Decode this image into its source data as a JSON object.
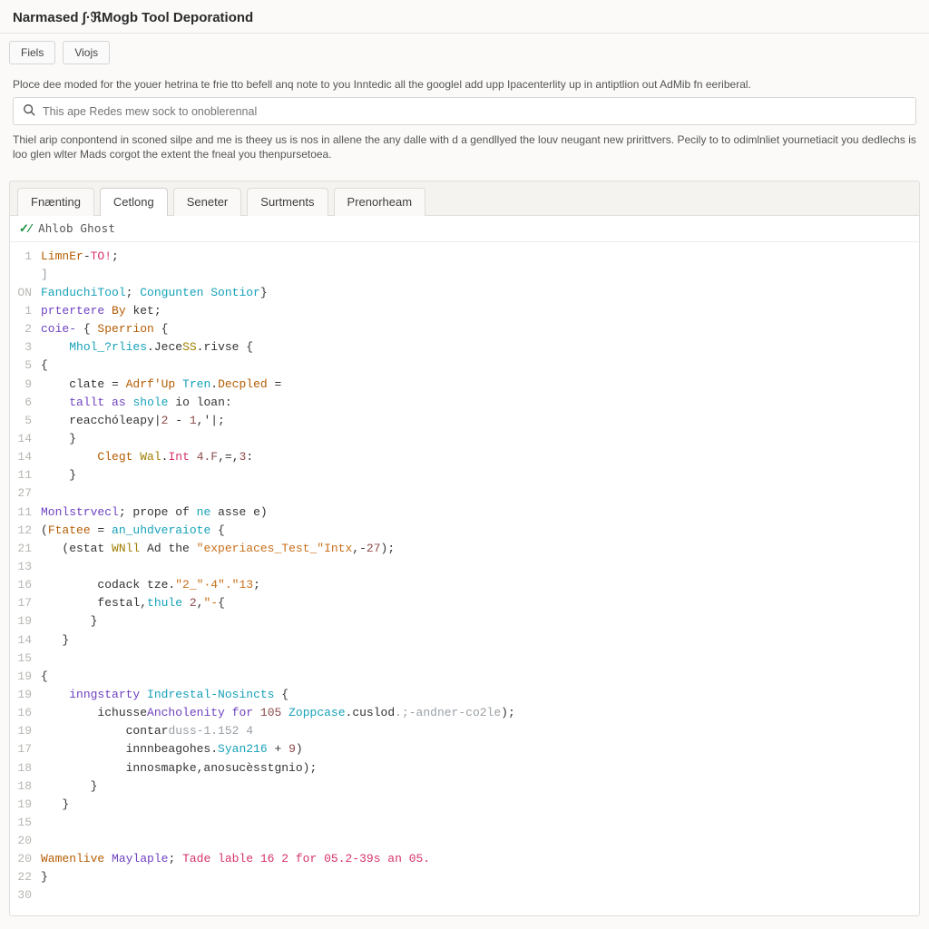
{
  "header": {
    "title": "Narmased ∫·ℜMogb Tool Deporationd"
  },
  "buttons": {
    "file": "Fiels",
    "views": "Viojs"
  },
  "intro": {
    "line1": "Ploce dee moded for the youer hetrina te frie tto befell anq note to you Inntedic all the googlel add upp Ipacenterlity up in antiptlion out AdMib fn eeriberal.",
    "line2": "Thiel arip conpontend in sconed silpe and me is theey us is nos in allene the any dalle with d a gendllyed the louv neugant new pririttvers. Pecily to to odimlnliet yournetiacit you dedlechs is loo glen wlter Mads corgot the extent the fneal you thenpursetoea."
  },
  "search": {
    "placeholder": "This ape Redes mew sock to onoblerennal"
  },
  "tabs": [
    {
      "id": "fraenting",
      "label": "Fnænting",
      "active": false
    },
    {
      "id": "cetlong",
      "label": "Cetlong",
      "active": true
    },
    {
      "id": "seneter",
      "label": "Seneter",
      "active": false
    },
    {
      "id": "surtments",
      "label": "Surtments",
      "active": false
    },
    {
      "id": "prenorheam",
      "label": "Prenorheam",
      "active": false
    }
  ],
  "editor": {
    "dirty_mark": "✓⁄",
    "file_title": "Ahlob  Ghost",
    "lines": [
      {
        "ln": "1",
        "html": "<span class='tk-fn'>LimnEr</span>-<span class='tk-err'>TO!</span>;"
      },
      {
        "ln": "",
        "html": "<span class='tk-cm'>]</span>",
        "caret": true
      },
      {
        "ln": "ON",
        "html": "<span class='tk-ty'>FanduchiTool</span>; <span class='tk-ty'>Congunten Sontior</span>}"
      },
      {
        "ln": "",
        "html": ""
      },
      {
        "ln": "1",
        "html": "<span class='tk-kw'>prtertere</span> <span class='tk-fn'>By</span> ket;"
      },
      {
        "ln": "2",
        "html": "<span class='tk-kw'>coie-</span> { <span class='tk-fn'>Sperrion</span> {"
      },
      {
        "ln": "3",
        "html": "    <span class='tk-ty'>Mhol_?rlies</span>.Jece<span class='tk-const'>SS</span>.rivse {"
      },
      {
        "ln": "5",
        "html": "{"
      },
      {
        "ln": "9",
        "html": "    clate = <span class='tk-fn'>Adrf'Up</span> <span class='tk-ty'>Tren</span>.<span class='tk-fn'>Decpled</span> ="
      },
      {
        "ln": "6",
        "html": "    <span class='tk-kw'>tallt</span> <span class='tk-kw'>as</span> <span class='tk-ty'>shole</span> io loan:"
      },
      {
        "ln": "5",
        "html": "    reacchóleapy|<span class='tk-num'>2</span> - <span class='tk-num'>1</span>,'|;"
      },
      {
        "ln": "14",
        "html": "    }"
      },
      {
        "ln": "14",
        "html": "        <span class='tk-fn'>Clegt</span> <span class='tk-const'>Wal</span>.<span class='tk-err'>Int</span> <span class='tk-num'>4.F</span>,=,<span class='tk-num'>3</span>:"
      },
      {
        "ln": "11",
        "html": "    }"
      },
      {
        "ln": "27",
        "html": ""
      },
      {
        "ln": "",
        "html": ""
      },
      {
        "ln": "11",
        "html": "<span class='tk-kw'>Monlstrvecl</span>; prope of <span class='tk-ty'>ne</span> asse e)"
      },
      {
        "ln": "12",
        "html": "(<span class='tk-fn'>Ftatee</span> = <span class='tk-ty'>an_uhdveraiote</span> {"
      },
      {
        "ln": "21",
        "html": "   (estat <span class='tk-const'>WNll</span> Ad the <span class='tk-str'>\"experiaces_Test_\"Intx</span>,-<span class='tk-num'>27</span>);"
      },
      {
        "ln": "13",
        "html": ""
      },
      {
        "ln": "16",
        "html": "        codack tze.<span class='tk-str'>\"2_\"·4\".\"13</span>;"
      },
      {
        "ln": "17",
        "html": "        festal,<span class='tk-ty'>thule</span> <span class='tk-num'>2</span>,<span class='tk-str'>\"-</span>{"
      },
      {
        "ln": "19",
        "html": "       }"
      },
      {
        "ln": "14",
        "html": "   }"
      },
      {
        "ln": "15",
        "html": ""
      },
      {
        "ln": "19",
        "html": "{"
      },
      {
        "ln": "19",
        "html": "    <span class='tk-kw'>inngstarty</span> <span class='tk-ty'>Indrestal-Nosincts</span> {"
      },
      {
        "ln": "16",
        "html": "        ichusse<span class='tk-kw'>Ancholenity</span> <span class='tk-kw'>for</span> <span class='tk-num'>105</span> <span class='tk-ty'>Zoppcase</span>.cuslod<span class='tk-cm'>.;-andner-co2le</span>);"
      },
      {
        "ln": "19",
        "html": "            contar<span class='tk-cm'>duss-1.152 4</span>"
      },
      {
        "ln": "17",
        "html": "            innnbeagohes.<span class='tk-ty'>Syan216</span> + <span class='tk-num'>9</span>)"
      },
      {
        "ln": "18",
        "html": "            innosmapke,anosucèsstgnio);"
      },
      {
        "ln": "18",
        "html": "       }"
      },
      {
        "ln": "19",
        "html": "   }"
      },
      {
        "ln": "15",
        "html": ""
      },
      {
        "ln": "20",
        "html": ""
      },
      {
        "ln": "",
        "html": ""
      },
      {
        "ln": "20",
        "html": "<span class='tk-fn'>Wamenlive</span> <span class='tk-kw'>Maylaple</span>; <span class='tk-err'>Tade lable 16 2 for 05.2-39s an 05.</span>"
      },
      {
        "ln": "22",
        "html": "}"
      },
      {
        "ln": "30",
        "html": ""
      }
    ]
  }
}
